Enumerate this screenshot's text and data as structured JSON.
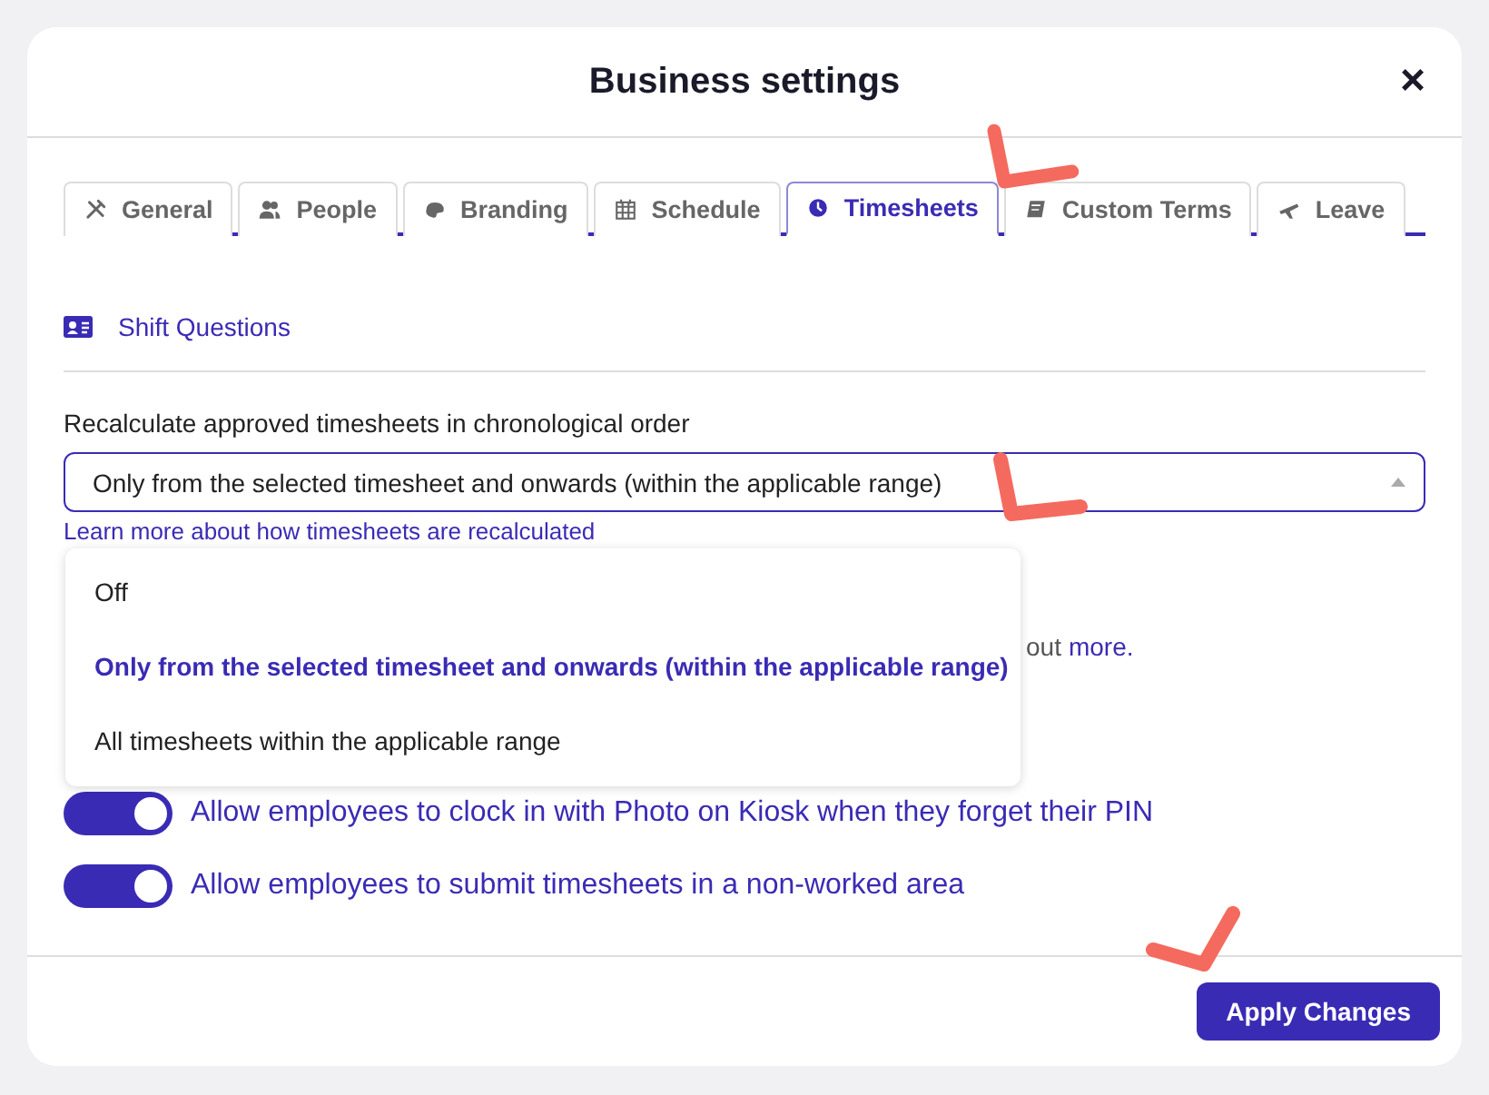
{
  "dialog": {
    "title": "Business settings",
    "close": "×"
  },
  "tabs": [
    {
      "label": "General",
      "selected": false
    },
    {
      "label": "People",
      "selected": false
    },
    {
      "label": "Branding",
      "selected": false
    },
    {
      "label": "Schedule",
      "selected": false
    },
    {
      "label": "Timesheets",
      "selected": true
    },
    {
      "label": "Custom Terms",
      "selected": false
    },
    {
      "label": "Leave",
      "selected": false
    }
  ],
  "section_link": "Shift Questions",
  "recalculate": {
    "label": "Recalculate approved timesheets in chronological order",
    "value": "Only from the selected timesheet and onwards (within the applicable range)",
    "help_link": "Learn more about how timesheets are recalculated",
    "expanded": true,
    "options": [
      {
        "label": "Off",
        "selected": false
      },
      {
        "label": "Only from the selected timesheet and onwards (within the applicable range)",
        "selected": true
      },
      {
        "label": "All timesheets within the applicable range",
        "selected": false
      }
    ]
  },
  "partly_hidden_note": {
    "text": "out",
    "link": "more."
  },
  "toggles": [
    {
      "label": "Allow employees to clock in with Photo on Kiosk when they forget their PIN",
      "on": true
    },
    {
      "label": "Allow employees to submit timesheets in a non-worked area",
      "on": true
    }
  ],
  "apply_button": "Apply Changes"
}
